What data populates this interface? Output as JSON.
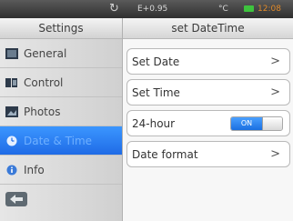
{
  "status": {
    "ev": "E+0.95",
    "temp_unit": "°C",
    "time": "12:08"
  },
  "sidebar": {
    "title": "Settings",
    "items": [
      {
        "label": "General",
        "icon": "general-icon"
      },
      {
        "label": "Control",
        "icon": "control-icon"
      },
      {
        "label": "Photos",
        "icon": "photos-icon"
      },
      {
        "label": "Date & Time",
        "icon": "clock-icon",
        "active": true
      },
      {
        "label": "Info",
        "icon": "info-icon"
      }
    ]
  },
  "main": {
    "title": "set DateTime",
    "rows": [
      {
        "label": "Set Date",
        "action": ">"
      },
      {
        "label": "Set Time",
        "action": ">"
      },
      {
        "label": "24-hour",
        "toggle": "ON"
      },
      {
        "label": "Date format",
        "action": ">"
      }
    ]
  },
  "colors": {
    "accent": "#1f6be6",
    "clock": "#e08a2a",
    "battery": "#3ec33e"
  }
}
